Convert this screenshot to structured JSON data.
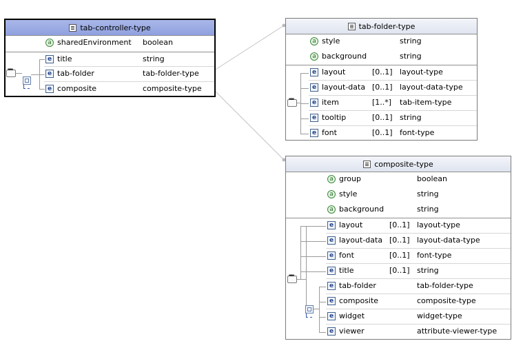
{
  "tab_controller": {
    "title": "tab-controller-type",
    "attributes": [
      {
        "name": "sharedEnvironment",
        "type": "boolean"
      }
    ],
    "elements": [
      {
        "name": "title",
        "type": "string"
      },
      {
        "name": "tab-folder",
        "type": "tab-folder-type"
      },
      {
        "name": "composite",
        "type": "composite-type"
      }
    ]
  },
  "tab_folder": {
    "title": "tab-folder-type",
    "attributes": [
      {
        "name": "style",
        "type": "string"
      },
      {
        "name": "background",
        "type": "string"
      }
    ],
    "elements": [
      {
        "name": "layout",
        "card": "[0..1]",
        "type": "layout-type"
      },
      {
        "name": "layout-data",
        "card": "[0..1]",
        "type": "layout-data-type"
      },
      {
        "name": "item",
        "card": "[1..*]",
        "type": "tab-item-type"
      },
      {
        "name": "tooltip",
        "card": "[0..1]",
        "type": "string"
      },
      {
        "name": "font",
        "card": "[0..1]",
        "type": "font-type"
      }
    ]
  },
  "composite": {
    "title": "composite-type",
    "attributes": [
      {
        "name": "group",
        "type": "boolean"
      },
      {
        "name": "style",
        "type": "string"
      },
      {
        "name": "background",
        "type": "string"
      }
    ],
    "elements": [
      {
        "name": "layout",
        "card": "[0..1]",
        "type": "layout-type"
      },
      {
        "name": "layout-data",
        "card": "[0..1]",
        "type": "layout-data-type"
      },
      {
        "name": "font",
        "card": "[0..1]",
        "type": "font-type"
      },
      {
        "name": "title",
        "card": "[0..1]",
        "type": "string"
      },
      {
        "name": "tab-folder",
        "card": "",
        "type": "tab-folder-type"
      },
      {
        "name": "composite",
        "card": "",
        "type": "composite-type"
      },
      {
        "name": "widget",
        "card": "",
        "type": "widget-type"
      },
      {
        "name": "viewer",
        "card": "",
        "type": "attribute-viewer-type"
      }
    ]
  },
  "icons": {
    "attribute": "attribute-icon",
    "element": "element-icon",
    "type": "complex-type-icon",
    "sequence": "sequence-icon",
    "choice": "choice-icon"
  },
  "colors": {
    "selected_header": "#9aa9e2",
    "header": "#e6eaf3",
    "connector": "#bdbdbd"
  }
}
